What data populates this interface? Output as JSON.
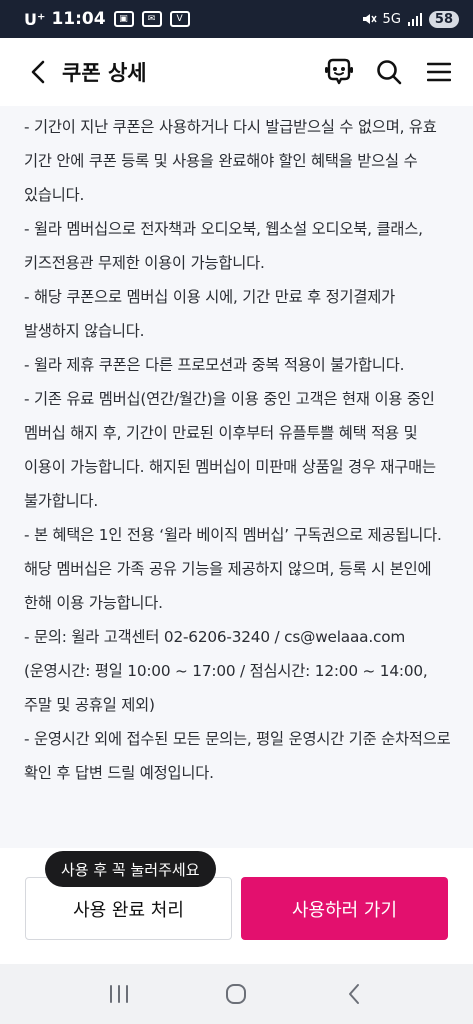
{
  "status_bar": {
    "carrier": "U⁺",
    "time": "11:04",
    "network": "5G",
    "battery": "58"
  },
  "app_bar": {
    "title": "쿠폰 상세"
  },
  "content": {
    "paragraphs": [
      "- 기간이 지난 쿠폰은 사용하거나 다시 발급받으실 수 없으며, 유효 기간 안에 쿠폰 등록 및 사용을 완료해야 할인 혜택을 받으실 수 있습니다.",
      "- 윌라 멤버십으로 전자책과 오디오북, 웹소설 오디오북, 클래스, 키즈전용관 무제한 이용이 가능합니다.",
      "- 해당 쿠폰으로 멤버십 이용 시에, 기간 만료 후 정기결제가 발생하지 않습니다.",
      "- 윌라 제휴 쿠폰은 다른 프로모션과 중복 적용이 불가합니다.",
      "- 기존 유료 멤버십(연간/월간)을 이용 중인 고객은 현재 이용 중인 멤버십 해지 후, 기간이 만료된 이후부터 유플투쁠 혜택 적용 및 이용이 가능합니다. 해지된 멤버십이 미판매 상품일 경우 재구매는 불가합니다.",
      "- 본 혜택은 1인 전용 ‘윌라 베이직 멤버십’ 구독권으로 제공됩니다. 해당 멤버십은 가족 공유 기능을 제공하지 않으며, 등록 시 본인에 한해 이용 가능합니다.",
      "- 문의: 윌라 고객센터 02-6206-3240 / cs@welaaa.com (운영시간: 평일 10:00 ~ 17:00 / 점심시간: 12:00 ~ 14:00, 주말 및 공휴일 제외)",
      "- 운영시간 외에 접수된 모든 문의는, 평일 운영시간 기준 순차적으로 확인 후 답변 드릴 예정입니다."
    ]
  },
  "bottom": {
    "tooltip": "사용 후 꼭 눌러주세요",
    "done_button": "사용 완료 처리",
    "use_button": "사용하러 가기"
  },
  "colors": {
    "accent": "#e3106e",
    "status_bar_bg": "#1a2233",
    "tooltip_bg": "#1b1b1d"
  },
  "icons": [
    "back-icon",
    "chatbot-icon",
    "search-icon",
    "menu-icon",
    "recents-icon",
    "home-icon",
    "nav-back-icon"
  ]
}
